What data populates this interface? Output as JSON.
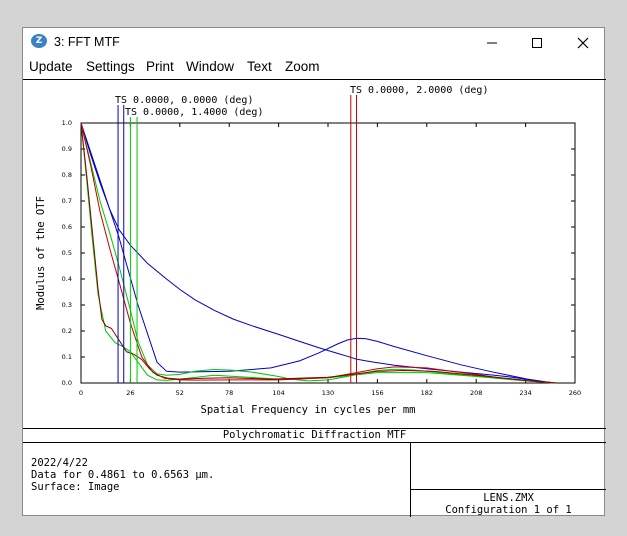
{
  "window": {
    "title": "3: FFT MTF",
    "app_icon": "zemax-app-icon",
    "controls": [
      "minimize-icon",
      "maximize-icon",
      "close-icon"
    ]
  },
  "menu": [
    "Update",
    "Settings",
    "Print",
    "Window",
    "Text",
    "Zoom"
  ],
  "colors": {
    "blue": "#0000c8",
    "green": "#00c800",
    "red": "#c80000",
    "dark_red": "#8b0000",
    "black": "#000000"
  },
  "chart_data": {
    "type": "line",
    "xlabel": "Spatial Frequency in cycles per mm",
    "ylabel": "Modulus of the OTF",
    "xlim": [
      0,
      260
    ],
    "ylim": [
      0,
      1
    ],
    "xticks": [
      0,
      26,
      52,
      78,
      104,
      130,
      156,
      182,
      208,
      234,
      260
    ],
    "yticks": [
      "0.0",
      "0.1",
      "0.2",
      "0.3",
      "0.4",
      "0.5",
      "0.6",
      "0.7",
      "0.8",
      "0.9",
      "1.0"
    ],
    "field_labels": [
      {
        "text": "TS 0.0000, 0.0000 (deg)",
        "color": "blue",
        "x": [
          19.5,
          22.5
        ]
      },
      {
        "text": "TS 0.0000, 1.4000 (deg)",
        "color": "green",
        "x": [
          26,
          29.5
        ]
      },
      {
        "text": "TS 0.0000, 2.0000 (deg)",
        "color": "red",
        "x": [
          142,
          145
        ]
      }
    ],
    "series": [
      {
        "color": "blue",
        "x": [
          0,
          5,
          10,
          15,
          20,
          26,
          35,
          45,
          52,
          60,
          70,
          80,
          90,
          104,
          115,
          125,
          135,
          140,
          145,
          150,
          156,
          165,
          182,
          200,
          215,
          225,
          235,
          245,
          250
        ],
        "y": [
          1.0,
          0.88,
          0.77,
          0.67,
          0.59,
          0.53,
          0.46,
          0.4,
          0.36,
          0.32,
          0.28,
          0.246,
          0.22,
          0.187,
          0.16,
          0.136,
          0.114,
          0.103,
          0.092,
          0.085,
          0.078,
          0.068,
          0.055,
          0.042,
          0.032,
          0.024,
          0.014,
          0.004,
          0.0
        ]
      },
      {
        "color": "blue",
        "x": [
          0,
          10,
          20,
          30,
          40,
          45,
          52,
          78,
          100,
          115,
          125,
          135,
          140,
          145,
          150,
          156,
          165,
          182,
          200,
          215,
          225,
          235,
          245,
          250
        ],
        "y": [
          1.0,
          0.78,
          0.56,
          0.3,
          0.08,
          0.045,
          0.042,
          0.045,
          0.058,
          0.085,
          0.115,
          0.15,
          0.165,
          0.172,
          0.17,
          0.16,
          0.14,
          0.105,
          0.07,
          0.045,
          0.03,
          0.015,
          0.004,
          0.0
        ]
      },
      {
        "color": "green",
        "x": [
          0,
          6,
          10,
          15,
          20,
          26,
          30,
          35,
          40,
          45,
          52,
          60,
          70,
          78,
          90,
          104,
          110,
          120,
          130,
          140,
          150,
          156,
          165,
          175,
          182,
          200,
          215,
          225,
          235,
          245,
          250
        ],
        "y": [
          1.0,
          0.82,
          0.7,
          0.58,
          0.45,
          0.28,
          0.16,
          0.07,
          0.035,
          0.03,
          0.033,
          0.045,
          0.052,
          0.05,
          0.042,
          0.025,
          0.015,
          0.008,
          0.012,
          0.025,
          0.04,
          0.048,
          0.053,
          0.05,
          0.045,
          0.032,
          0.022,
          0.015,
          0.008,
          0.002,
          0.0
        ]
      },
      {
        "color": "green",
        "x": [
          0,
          3,
          6,
          9,
          13,
          18,
          22,
          26,
          30,
          35,
          40,
          45,
          52,
          70,
          104,
          130,
          156,
          182,
          208,
          234,
          250
        ],
        "y": [
          1.0,
          0.78,
          0.55,
          0.34,
          0.2,
          0.155,
          0.14,
          0.12,
          0.08,
          0.03,
          0.012,
          0.01,
          0.015,
          0.03,
          0.015,
          0.02,
          0.04,
          0.04,
          0.025,
          0.008,
          0.0
        ]
      },
      {
        "color": "red",
        "x": [
          0,
          5,
          10,
          15,
          20,
          26,
          32,
          38,
          44,
          52,
          60,
          78,
          104,
          130,
          145,
          156,
          165,
          175,
          182,
          195,
          208,
          220,
          234,
          250
        ],
        "y": [
          1.0,
          0.84,
          0.66,
          0.52,
          0.39,
          0.23,
          0.1,
          0.04,
          0.018,
          0.012,
          0.011,
          0.012,
          0.012,
          0.02,
          0.04,
          0.055,
          0.062,
          0.06,
          0.058,
          0.045,
          0.033,
          0.02,
          0.01,
          0.0
        ]
      },
      {
        "color": "dark_red",
        "x": [
          0,
          3,
          6,
          9,
          11,
          13,
          16,
          20,
          24,
          28,
          32,
          36,
          40,
          46,
          52,
          65,
          78,
          100,
          130,
          145,
          156,
          170,
          185,
          208,
          234,
          250
        ],
        "y": [
          1.0,
          0.8,
          0.58,
          0.36,
          0.245,
          0.22,
          0.21,
          0.165,
          0.12,
          0.11,
          0.09,
          0.055,
          0.03,
          0.018,
          0.015,
          0.018,
          0.02,
          0.015,
          0.022,
          0.035,
          0.045,
          0.048,
          0.045,
          0.03,
          0.01,
          0.0
        ]
      }
    ]
  },
  "caption": "Polychromatic Diffraction MTF",
  "info": {
    "date": "2022/4/22",
    "wavelength": "Data for 0.4861 to 0.6563 µm.",
    "surface": "Surface: Image",
    "file": "LENS.ZMX",
    "config": "Configuration 1 of 1"
  }
}
